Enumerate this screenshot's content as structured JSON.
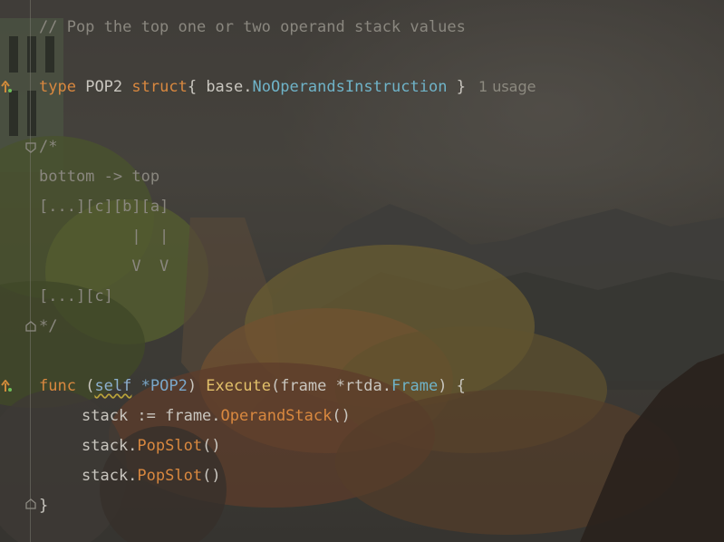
{
  "editor": {
    "language": "Go",
    "usage_hint": "1 usage",
    "lines": {
      "l1": "// Pop the top one or two operand stack values",
      "l2_kw_type": "type",
      "l2_name": "POP2",
      "l2_kw_struct": "struct",
      "l2_brace_open": "{ ",
      "l2_pkg": "base",
      "l2_dot": ".",
      "l2_embed": "NoOperandsInstruction",
      "l2_brace_close": " }",
      "l3": "/*",
      "l4": "bottom -> top",
      "l5": "[...][c][b][a]",
      "l6": "          |  |",
      "l7": "          V  V",
      "l8": "[...][c]",
      "l9": "*/",
      "l10_kw_func": "func",
      "l10_paren_open": " (",
      "l10_self": "self",
      "l10_recv_type": " *POP2",
      "l10_paren_close": ") ",
      "l10_fn": "Execute",
      "l10_params_open": "(frame *rtda.",
      "l10_param_type": "Frame",
      "l10_params_close": ") {",
      "l11_a": "stack := frame.",
      "l11_method": "OperandStack",
      "l11_b": "()",
      "l12_a": "stack.",
      "l12_method": "PopSlot",
      "l12_b": "()",
      "l13_a": "stack.",
      "l13_method": "PopSlot",
      "l13_b": "()",
      "l14": "}"
    }
  },
  "gutter": {
    "icons": [
      "implemented-arrow-icon",
      "implemented-arrow-icon",
      "fold-icon",
      "fold-icon",
      "fold-icon"
    ]
  },
  "colors": {
    "keyword": "#d9883f",
    "comment": "#8a877f",
    "function": "#e2c06a",
    "type_ref": "#6fb3c8",
    "text": "#c9c6bf"
  }
}
